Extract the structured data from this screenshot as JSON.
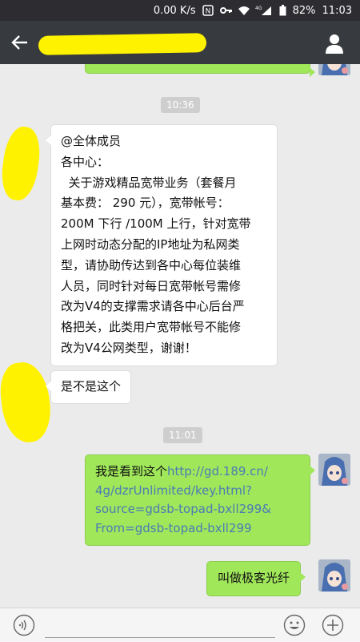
{
  "status_bar": {
    "speed": "0.00 K/s",
    "network": "4G",
    "battery": "82%",
    "time": "11:03"
  },
  "header": {
    "back_icon": "arrow-left-icon",
    "profile_icon": "person-icon"
  },
  "messages": {
    "time_1": "10:36",
    "announcement_lines": [
      "@全体成员",
      "各中心：",
      "  关于游戏精品宽带业务（套餐月",
      "基本费： 290 元），宽带帐号：",
      "200M 下行 /100M 上行，针对宽带",
      "上网时动态分配的IP地址为私网类",
      "型，请协助传达到各中心每位装维",
      "人员，同时针对每日宽带帐号需修",
      "改为V4的支撑需求请各中心后台严",
      "格把关，此类用户宽带帐号不能修",
      "改为V4公网类型，谢谢！"
    ],
    "question": "是不是这个",
    "time_2": "11:01",
    "link_msg": {
      "prefix": "我是看到这个",
      "url_lines": [
        "http://gd.189.cn/",
        "4g/dzrUnlimited/key.html?",
        "source=gdsb-topad-bxll299&",
        "From=gdsb-topad-bxll299"
      ]
    },
    "reply": "叫做极客光纤"
  },
  "input_bar": {
    "placeholder": ""
  },
  "colors": {
    "outgoing_bubble": "#a0e75a",
    "incoming_bubble": "#ffffff",
    "link": "#4a7bb5",
    "title_bar": "#373b3f",
    "redaction": "#fff200"
  }
}
